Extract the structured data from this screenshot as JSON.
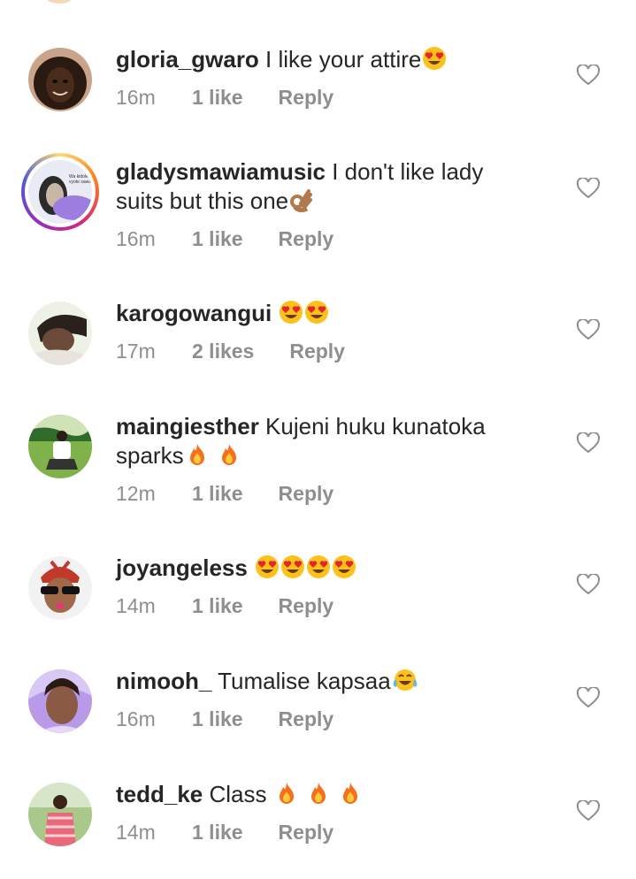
{
  "comments": [
    {
      "username": "gloria_gwaro",
      "text": " I like your attire",
      "emojis": [
        "heart-eyes"
      ],
      "time": "16m",
      "likes": "1 like",
      "reply": "Reply"
    },
    {
      "username": "gladysmawiamusic",
      "text": " I don't like lady suits but this one",
      "emojis": [
        "ok-hand"
      ],
      "time": "16m",
      "likes": "1 like",
      "reply": "Reply",
      "avatar_caption": [
        "Wa kidole",
        "vyote sawa"
      ]
    },
    {
      "username": "karogowangui",
      "text": " ",
      "emojis": [
        "heart-eyes",
        "heart-eyes"
      ],
      "time": "17m",
      "likes": "2 likes",
      "reply": "Reply"
    },
    {
      "username": "maingiesther",
      "text": " Kujeni huku kunatoka sparks",
      "emojis": [
        "fire",
        "fire"
      ],
      "time": "12m",
      "likes": "1 like",
      "reply": "Reply"
    },
    {
      "username": "joyangeless",
      "text": " ",
      "emojis": [
        "heart-eyes",
        "heart-eyes",
        "heart-eyes",
        "heart-eyes"
      ],
      "time": "14m",
      "likes": "1 like",
      "reply": "Reply"
    },
    {
      "username": "nimooh_",
      "text": " Tumalise kapsaa",
      "emojis": [
        "tears-of-joy"
      ],
      "time": "16m",
      "likes": "1 like",
      "reply": "Reply"
    },
    {
      "username": "tedd_ke",
      "text": " Class ",
      "emojis": [
        "fire",
        "fire",
        "fire"
      ],
      "time": "14m",
      "likes": "1 like",
      "reply": "Reply"
    }
  ],
  "colors": {
    "text": "#262626",
    "meta": "#8e8e8e",
    "heart_outline": "#8e8e8e"
  }
}
